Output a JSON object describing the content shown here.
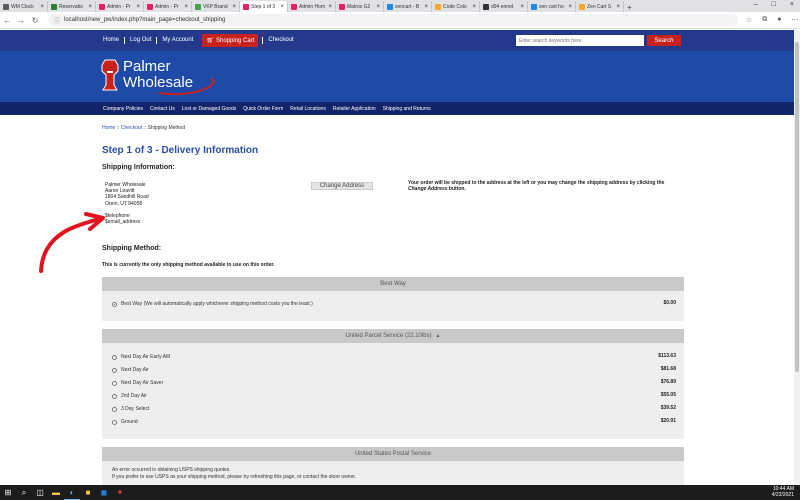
{
  "browser": {
    "tabs": [
      {
        "title": "WM Clock",
        "color": "#5a5a5a",
        "active": false
      },
      {
        "title": "Reservatio",
        "color": "#2e7d32",
        "active": false
      },
      {
        "title": "Admin - Pr",
        "color": "#e91e63",
        "active": false
      },
      {
        "title": "Admin - Pr",
        "color": "#e91e63",
        "active": false
      },
      {
        "title": "VKP Brand",
        "color": "#43a047",
        "active": false
      },
      {
        "title": "Step 1 of 3",
        "color": "#e91e63",
        "active": true
      },
      {
        "title": "Admin Hom",
        "color": "#e91e63",
        "active": false
      },
      {
        "title": "Matrox G2",
        "color": "#e91e63",
        "active": false
      },
      {
        "title": "zencart - B",
        "color": "#1e88e5",
        "active": false
      },
      {
        "title": "Code Colo",
        "color": "#f9a825",
        "active": false
      },
      {
        "title": "d94 ennet",
        "color": "#333333",
        "active": false
      },
      {
        "title": "zen cart ho",
        "color": "#1e88e5",
        "active": false
      },
      {
        "title": "Zen Cart S",
        "color": "#f9a825",
        "active": false
      }
    ],
    "url": "localhost/new_pw/index.php?main_page=checkout_shipping"
  },
  "header": {
    "top_links": [
      "Home",
      "Log Out",
      "My Account"
    ],
    "cart_label": "Shopping Cart",
    "checkout_label": "Checkout",
    "search_placeholder": "Enter search keywords here",
    "search_button": "Search"
  },
  "logo": {
    "line1": "Palmer",
    "line2": "Wholesale"
  },
  "category_nav": [
    "Company Policies",
    "Contact Us",
    "Lost or Damaged Goods",
    "Quick Order Form",
    "Retail Locations",
    "Retailer Application",
    "Shipping and Returns"
  ],
  "breadcrumb": {
    "home": "Home",
    "checkout": "Checkout",
    "current": "Shipping Method",
    "sep": "::"
  },
  "page": {
    "title": "Step 1 of 3 - Delivery Information",
    "shipping_info_heading": "Shipping Information:",
    "address": [
      "Palmer Wholesale",
      "Aaron Leavitt",
      "1804 Sandhill Road",
      "Orem, UT 84058",
      "",
      "$telephone",
      "$email_address"
    ],
    "change_address_button": "Change Address",
    "address_note_1": "Your order will be shipped to the address at the left or you may change the shipping address by clicking the ",
    "address_note_em": "Change Address",
    "address_note_2": " button.",
    "shipping_method_heading": "Shipping Method:",
    "only_method_text": "This is currently the only shipping method available to use on this order."
  },
  "panels": {
    "best_way": {
      "title": "Best Way",
      "option": "Best Way (We will automatically apply whichever shipping method costs you the least.)",
      "price": "$0.00"
    },
    "ups": {
      "title": "United Parcel Service (22.10lbs)",
      "options": [
        {
          "label": "Next Day Air Early AM",
          "price": "$113.63"
        },
        {
          "label": "Next Day Air",
          "price": "$81.68"
        },
        {
          "label": "Next Day Air Saver",
          "price": "$76.89"
        },
        {
          "label": "2nd Day Air",
          "price": "$55.05"
        },
        {
          "label": "3 Day Select",
          "price": "$39.52"
        },
        {
          "label": "Ground",
          "price": "$20.91"
        }
      ]
    },
    "usps": {
      "title": "United States Postal Service",
      "message_1": "An error occurred in obtaining USPS shipping quotes.",
      "message_2": "If you prefer to use USPS as your shipping method, please try refreshing this page, or contact the store owner."
    }
  },
  "taskbar": {
    "time": "10:44 AM",
    "date": "4/22/2021"
  }
}
